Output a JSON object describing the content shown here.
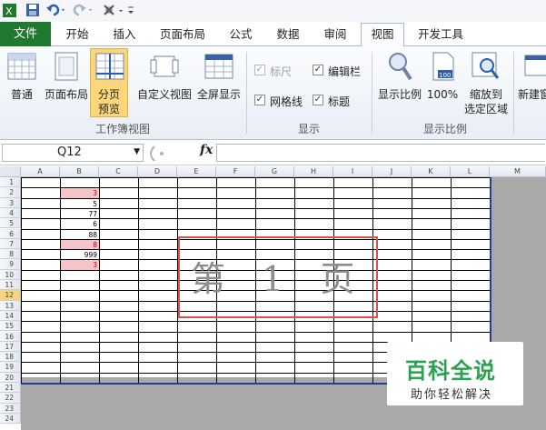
{
  "quick_access": {
    "icons": [
      "excel-app-icon",
      "save-icon",
      "undo-icon",
      "redo-icon",
      "customize-qat-icon"
    ]
  },
  "tabs": {
    "file": "文件",
    "items": [
      "开始",
      "插入",
      "页面布局",
      "公式",
      "数据",
      "审阅",
      "视图",
      "开发工具"
    ],
    "active": "视图"
  },
  "ribbon": {
    "workbook_views": {
      "group_label": "工作簿视图",
      "normal": "普通",
      "page_layout": "页面布局",
      "page_break_preview_line1": "分页",
      "page_break_preview_line2": "预览",
      "custom_views": "自定义视图",
      "full_screen": "全屏显示"
    },
    "show": {
      "group_label": "显示",
      "ruler": "标尺",
      "formula_bar": "编辑栏",
      "gridlines": "网格线",
      "headings": "标题"
    },
    "zoom": {
      "group_label": "显示比例",
      "zoom": "显示比例",
      "zoom_100": "100%",
      "zoom_to_selection_line1": "缩放到",
      "zoom_to_selection_line2": "选定区域",
      "icon_100_text": "100"
    },
    "window": {
      "new_window": "新建窗"
    }
  },
  "formula_bar": {
    "name_box": "Q12",
    "fx": "fx",
    "formula": ""
  },
  "sheet": {
    "columns": [
      "A",
      "B",
      "C",
      "D",
      "E",
      "F",
      "G",
      "H",
      "I",
      "J",
      "K",
      "L",
      "M"
    ],
    "rows": [
      "1",
      "2",
      "3",
      "4",
      "5",
      "6",
      "7",
      "8",
      "9",
      "10",
      "11",
      "12",
      "13",
      "14",
      "15",
      "16",
      "17",
      "18",
      "19",
      "20",
      "21",
      "22",
      "23",
      "24"
    ],
    "selected_row": "12",
    "column_b_values": [
      "3",
      "5",
      "77",
      "6",
      "88",
      "8",
      "999",
      "3"
    ],
    "page_watermark": "第 1 页"
  },
  "logo": {
    "line1": "百科全说",
    "line2": "助你轻松解决"
  }
}
